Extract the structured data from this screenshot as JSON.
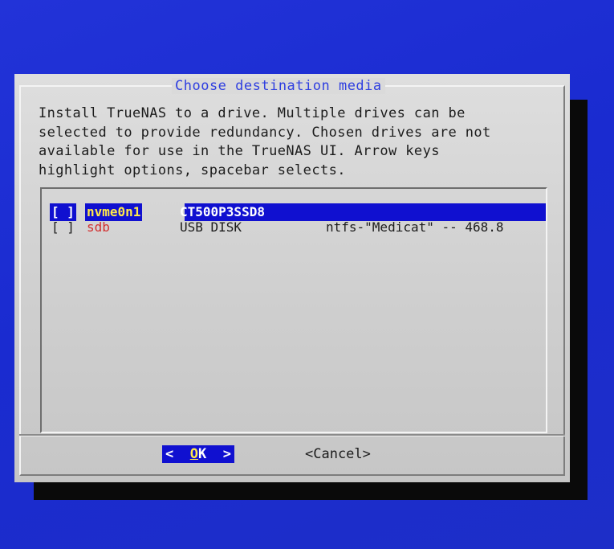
{
  "dialog": {
    "title": "Choose destination media",
    "description": [
      "Install TrueNAS to a drive. Multiple drives can be",
      "selected to provide redundancy. Chosen drives are not",
      "available for use in the TrueNAS UI. Arrow keys",
      "highlight options, spacebar selects."
    ]
  },
  "drives": [
    {
      "checkbox": "[ ]",
      "name": "nvme0n1",
      "model": "CT500P3SSD8",
      "detail": "",
      "highlighted": true,
      "checked": false
    },
    {
      "checkbox": "[ ]",
      "name": "sdb",
      "model": "USB DISK",
      "detail": "ntfs-\"Medicat\" -- 468.8",
      "highlighted": false,
      "checked": false
    }
  ],
  "buttons": {
    "ok_left": "<",
    "ok_hotkey": "O",
    "ok_rest": "K",
    "ok_right": ">",
    "cancel": "<Cancel>"
  },
  "colors": {
    "background": "#1a2bd0",
    "highlight": "#1010d0",
    "title": "#2f3fe0",
    "drive_name": "#d23030",
    "hotkey": "#ffe94a"
  }
}
